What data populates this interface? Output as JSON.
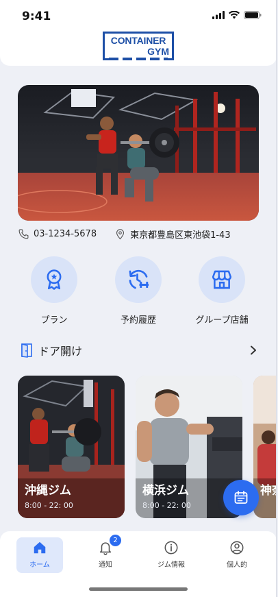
{
  "status_bar": {
    "time": "9:41"
  },
  "logo": {
    "line1": "CONTAINER",
    "line2": "GYM"
  },
  "contact": {
    "phone": "03-1234-5678",
    "address": "東京都豊島区東池袋1-43"
  },
  "quick_menu": [
    {
      "label": "プラン",
      "icon": "award-icon"
    },
    {
      "label": "予約履歴",
      "icon": "history-icon"
    },
    {
      "label": "グループ店舗",
      "icon": "store-icon"
    }
  ],
  "door": {
    "label": "ドア開け"
  },
  "gyms": [
    {
      "name": "沖縄ジム",
      "hours": "8:00 - 22: 00"
    },
    {
      "name": "横浜ジム",
      "hours": "8:00 - 22: 00"
    },
    {
      "name": "神奈",
      "hours": ""
    }
  ],
  "bottom_nav": [
    {
      "label": "ホーム",
      "icon": "home-icon",
      "active": true
    },
    {
      "label": "通知",
      "icon": "bell-icon",
      "badge": "2"
    },
    {
      "label": "ジム情報",
      "icon": "info-icon"
    },
    {
      "label": "個人的",
      "icon": "user-icon"
    }
  ],
  "colors": {
    "accent": "#2c6cf0",
    "icon_bg": "#d9e3f8",
    "logo_blue": "#1d4fa6"
  }
}
